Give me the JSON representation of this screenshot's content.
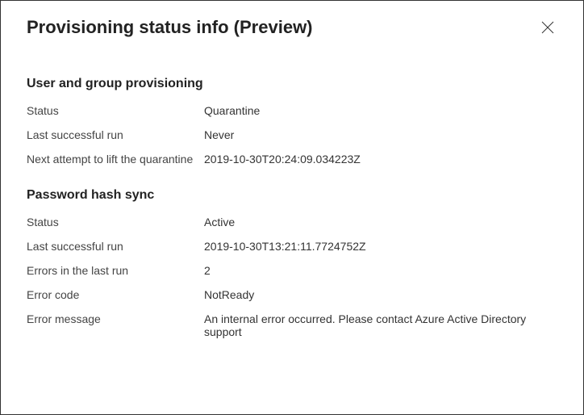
{
  "header": {
    "title": "Provisioning status info (Preview)"
  },
  "sections": {
    "userGroup": {
      "heading": "User and group provisioning",
      "status_label": "Status",
      "status_value": "Quarantine",
      "lastRun_label": "Last successful run",
      "lastRun_value": "Never",
      "nextAttempt_label": "Next attempt to lift the quarantine",
      "nextAttempt_value": "2019-10-30T20:24:09.034223Z"
    },
    "passwordHash": {
      "heading": "Password hash sync",
      "status_label": "Status",
      "status_value": "Active",
      "lastRun_label": "Last successful run",
      "lastRun_value": "2019-10-30T13:21:11.7724752Z",
      "errors_label": "Errors in the last run",
      "errors_value": "2",
      "errorCode_label": "Error code",
      "errorCode_value": "NotReady",
      "errorMsg_label": "Error message",
      "errorMsg_value": "An internal error occurred. Please contact Azure Active Directory support"
    }
  }
}
